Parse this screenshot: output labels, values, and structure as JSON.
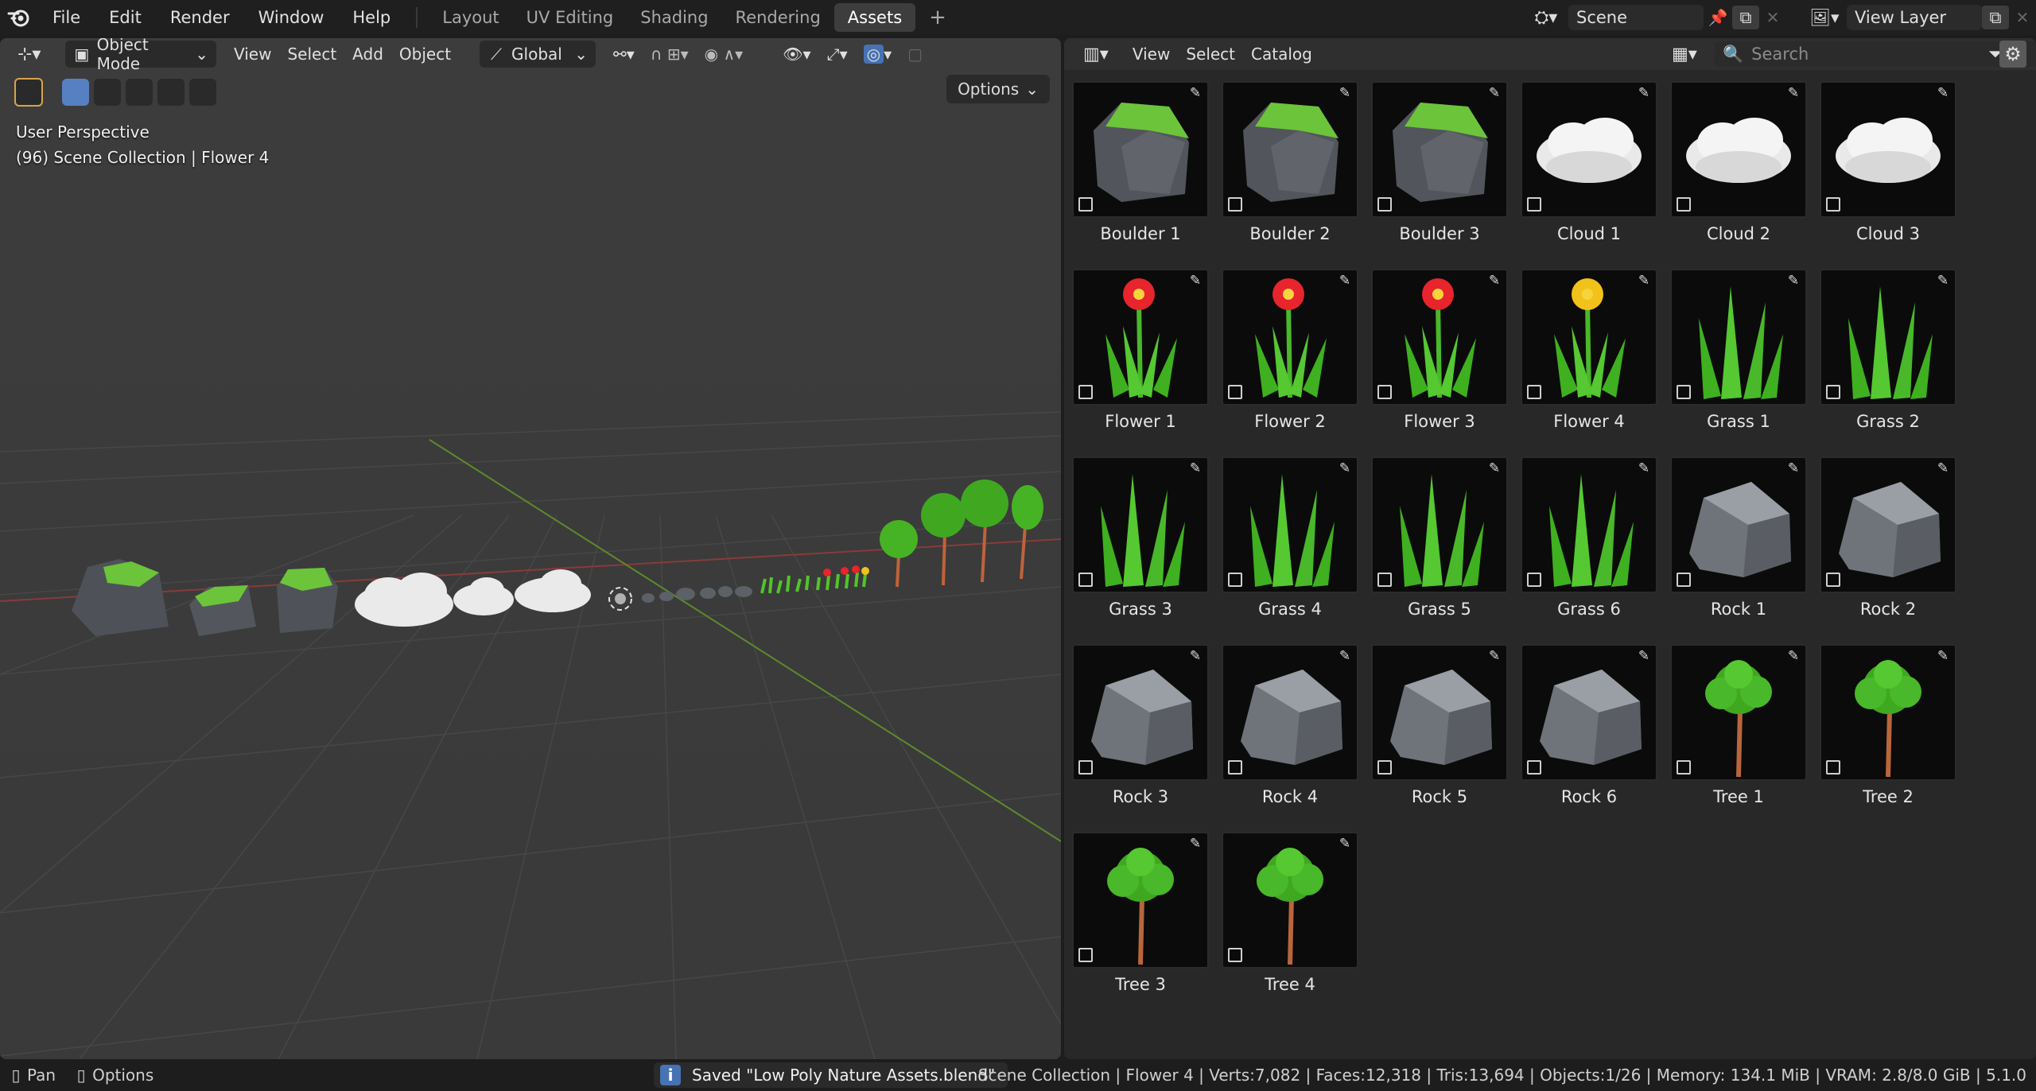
{
  "topbar": {
    "menus": [
      "File",
      "Edit",
      "Render",
      "Window",
      "Help"
    ],
    "workspaces": [
      "Layout",
      "UV Editing",
      "Shading",
      "Rendering",
      "Assets"
    ],
    "active_workspace": "Assets",
    "add_workspace": "+",
    "scene": "Scene",
    "view_layer": "View Layer"
  },
  "viewport": {
    "mode": "Object Mode",
    "menus": [
      "View",
      "Select",
      "Add",
      "Object"
    ],
    "transform_orientation": "Global",
    "options": "Options",
    "info_line1": "User Perspective",
    "info_line2": "(96) Scene Collection | Flower 4"
  },
  "browser": {
    "menus": [
      "View",
      "Select",
      "Catalog"
    ],
    "search_placeholder": "Search",
    "assets": [
      {
        "name": "Boulder 1",
        "kind": "boulder"
      },
      {
        "name": "Boulder 2",
        "kind": "boulder"
      },
      {
        "name": "Boulder 3",
        "kind": "boulder"
      },
      {
        "name": "Cloud 1",
        "kind": "cloud"
      },
      {
        "name": "Cloud 2",
        "kind": "cloud"
      },
      {
        "name": "Cloud 3",
        "kind": "cloud"
      },
      {
        "name": "Flower 1",
        "kind": "flower",
        "color": "#e8242c"
      },
      {
        "name": "Flower 2",
        "kind": "flower",
        "color": "#e8242c"
      },
      {
        "name": "Flower 3",
        "kind": "flower",
        "color": "#e8242c"
      },
      {
        "name": "Flower 4",
        "kind": "flower",
        "color": "#f2c21a"
      },
      {
        "name": "Grass 1",
        "kind": "grass"
      },
      {
        "name": "Grass 2",
        "kind": "grass"
      },
      {
        "name": "Grass 3",
        "kind": "grass"
      },
      {
        "name": "Grass 4",
        "kind": "grass"
      },
      {
        "name": "Grass 5",
        "kind": "grass"
      },
      {
        "name": "Grass 6",
        "kind": "grass"
      },
      {
        "name": "Rock 1",
        "kind": "rock"
      },
      {
        "name": "Rock 2",
        "kind": "rock"
      },
      {
        "name": "Rock 3",
        "kind": "rock"
      },
      {
        "name": "Rock 4",
        "kind": "rock"
      },
      {
        "name": "Rock 5",
        "kind": "rock"
      },
      {
        "name": "Rock 6",
        "kind": "rock"
      },
      {
        "name": "Tree 1",
        "kind": "tree"
      },
      {
        "name": "Tree 2",
        "kind": "tree"
      },
      {
        "name": "Tree 3",
        "kind": "tree"
      },
      {
        "name": "Tree 4",
        "kind": "tree"
      }
    ]
  },
  "statusbar": {
    "pan": "Pan",
    "options": "Options",
    "saved_message": "Saved \"Low Poly Nature Assets.blend\"",
    "collection": "Scene Collection",
    "object": "Flower 4",
    "verts": "Verts:7,082",
    "faces": "Faces:12,318",
    "tris": "Tris:13,694",
    "objects": "Objects:1/26",
    "memory": "Memory: 134.1 MiB",
    "vram": "VRAM: 2.8/8.0 GiB",
    "version": "5.1.0"
  },
  "colors": {
    "accent": "#4772b3",
    "grass_green": "#49b82a",
    "rock_gray": "#6f737a"
  }
}
